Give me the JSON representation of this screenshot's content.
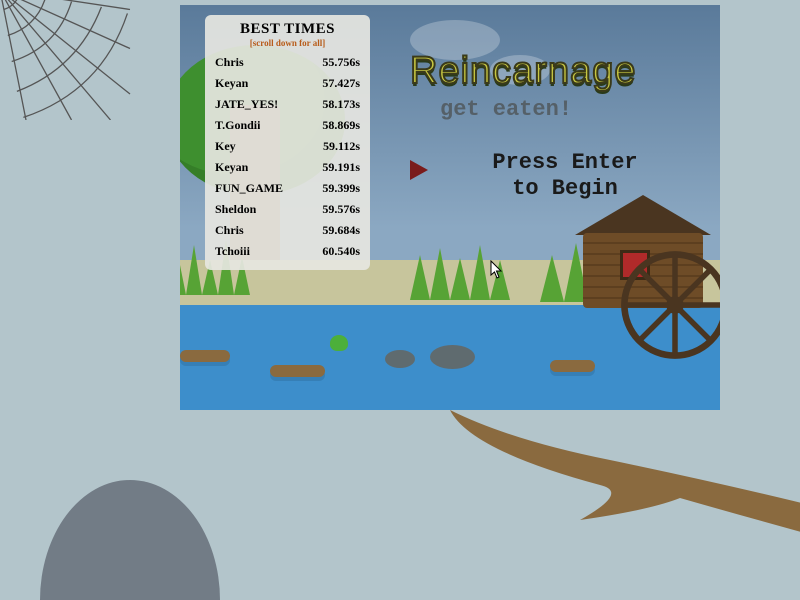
{
  "title": "Reincarnage",
  "subtitle": "get eaten!",
  "press_prompt": "Press Enter\nto Begin",
  "leaderboard": {
    "heading": "BEST TIMES",
    "hint": "[scroll down for all]",
    "entries": [
      {
        "name": "Chris",
        "time": "55.756s"
      },
      {
        "name": "Keyan",
        "time": "57.427s"
      },
      {
        "name": "JATE_YES!",
        "time": "58.173s"
      },
      {
        "name": "T.Gondii",
        "time": "58.869s"
      },
      {
        "name": "Key",
        "time": "59.112s"
      },
      {
        "name": "Keyan",
        "time": "59.191s"
      },
      {
        "name": "FUN_GAME",
        "time": "59.399s"
      },
      {
        "name": "Sheldon",
        "time": "59.576s"
      },
      {
        "name": "Chris",
        "time": "59.684s"
      },
      {
        "name": "Tchoiii",
        "time": "60.540s"
      }
    ]
  },
  "colors": {
    "accent_title": "#c7c742",
    "accent_play": "#7a1b1b",
    "water": "#3d8ecb"
  }
}
